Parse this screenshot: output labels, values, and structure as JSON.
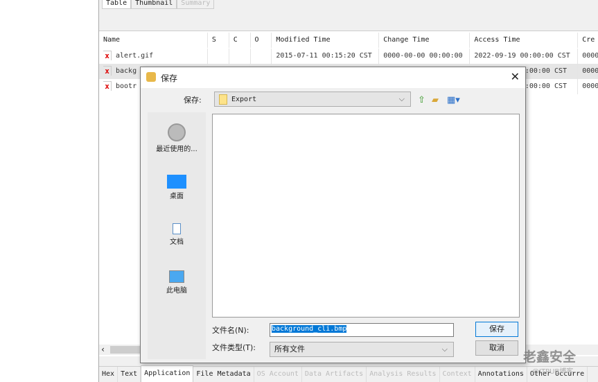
{
  "top_tabs": [
    {
      "label": "Table",
      "state": "active"
    },
    {
      "label": "Thumbnail",
      "state": "normal"
    },
    {
      "label": "Summary",
      "state": "disabled"
    }
  ],
  "table": {
    "columns": [
      "Name",
      "S",
      "C",
      "O",
      "Modified Time",
      "Change Time",
      "Access Time",
      "Cre"
    ],
    "rows": [
      {
        "name": "alert.gif",
        "s": "",
        "c": "",
        "o": "",
        "modified": "2015-07-11 00:15:20 CST",
        "change": "0000-00-00 00:00:00",
        "access": "2022-09-19 00:00:00 CST",
        "created": "0000"
      },
      {
        "name": "backg",
        "s": "",
        "c": "",
        "o": "",
        "modified": "",
        "change": "",
        "access": ":00:00 CST",
        "created": "0000"
      },
      {
        "name": "bootr",
        "s": "",
        "c": "",
        "o": "",
        "modified": "",
        "change": "",
        "access": ":00:00 CST",
        "created": "0000"
      }
    ]
  },
  "bottom_tabs": [
    {
      "label": "Hex",
      "state": "normal"
    },
    {
      "label": "Text",
      "state": "normal"
    },
    {
      "label": "Application",
      "state": "active"
    },
    {
      "label": "File Metadata",
      "state": "normal"
    },
    {
      "label": "OS Account",
      "state": "disabled"
    },
    {
      "label": "Data Artifacts",
      "state": "disabled"
    },
    {
      "label": "Analysis Results",
      "state": "disabled"
    },
    {
      "label": "Context",
      "state": "disabled"
    },
    {
      "label": "Annotations",
      "state": "normal"
    },
    {
      "label": "Other Occurre",
      "state": "normal"
    }
  ],
  "dialog": {
    "title": "保存",
    "save_in_label": "保存:",
    "save_in_value": "Export",
    "places": [
      "最近使用的...",
      "桌面",
      "文档",
      "此电脑"
    ],
    "filename_label": "文件名(N):",
    "filename_value": "background_cli.bmp",
    "filetype_label": "文件类型(T):",
    "filetype_value": "所有文件",
    "save_button": "保存",
    "cancel_button": "取消"
  },
  "watermark": {
    "brand": "老鑫安全",
    "sub": "@ITPUB博客"
  }
}
